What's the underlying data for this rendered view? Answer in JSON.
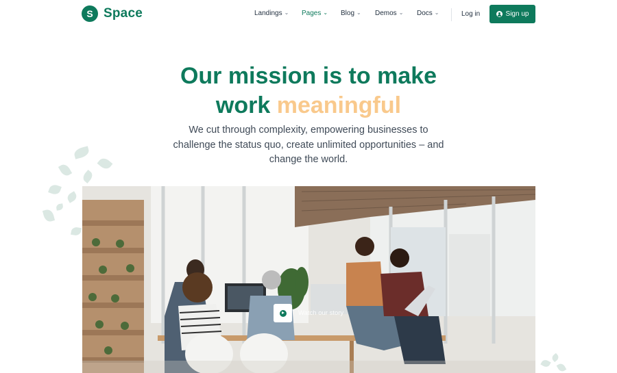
{
  "brand": {
    "logo_letter": "S",
    "name": "Space",
    "color": "#0e7a5c"
  },
  "nav": {
    "items": [
      {
        "label": "Landings",
        "active": false
      },
      {
        "label": "Pages",
        "active": true
      },
      {
        "label": "Blog",
        "active": false
      },
      {
        "label": "Demos",
        "active": false
      },
      {
        "label": "Docs",
        "active": false
      }
    ],
    "login_label": "Log in",
    "signup_label": "Sign up"
  },
  "hero": {
    "title_line1": "Our mission is to make",
    "title_line2_plain": "work",
    "title_line2_accent": "meaningful",
    "subtitle": "We cut through complexity, empowering businesses to challenge the status quo, create unlimited opportunities – and change the world.",
    "accent_color": "#f9c98c"
  },
  "video": {
    "label": "Watch our story"
  },
  "icons": [
    "chevron-down-icon",
    "user-circle-icon",
    "play-icon"
  ]
}
